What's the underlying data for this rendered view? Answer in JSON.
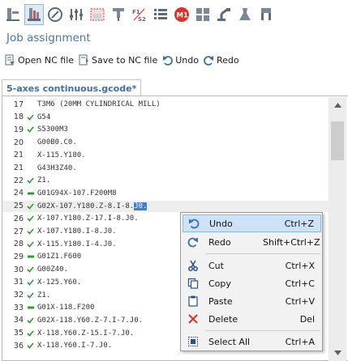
{
  "toolbar": {
    "icons": [
      "machine-setup-icon",
      "job-assignment-icon",
      "compass-icon",
      "sliders-icon",
      "stock-icon",
      "tool-icon",
      "f1-s2-icon",
      "list-icon",
      "m1-icon",
      "grid-icon",
      "robot-icon",
      "lab-icon",
      "gripper-icon"
    ],
    "f1": "F1",
    "s2": "S2",
    "m1": "M1"
  },
  "heading": "Job assignment",
  "actions": {
    "open": "Open NC file",
    "save": "Save to NC file",
    "undo": "Undo",
    "redo": "Redo"
  },
  "document": {
    "tab": "5-axes continuous.gcode*"
  },
  "lines": [
    {
      "num": "17",
      "status": "none",
      "code": "T3M6 (20MM CYLINDRICAL MILL)"
    },
    {
      "num": "18",
      "status": "check",
      "code": "G54"
    },
    {
      "num": "19",
      "status": "check",
      "code": "S5300M3"
    },
    {
      "num": "20",
      "status": "none",
      "code": "G00B0.C0."
    },
    {
      "num": "21",
      "status": "none",
      "code": "X-115.Y180."
    },
    {
      "num": "21",
      "status": "none",
      "code": "G43H3Z40."
    },
    {
      "num": "22",
      "status": "check",
      "code": "Z1."
    },
    {
      "num": "24",
      "status": "dash",
      "code": "G01G94X-107.F200M8"
    },
    {
      "num": "25",
      "status": "check",
      "code": "G02X-107.Y180.Z-8.I-8.",
      "sel": "J0."
    },
    {
      "num": "26",
      "status": "check",
      "code": "X-107.Y180.Z-17.I-8.J0."
    },
    {
      "num": "27",
      "status": "check",
      "code": "X-107.Y180.I-8.J0."
    },
    {
      "num": "28",
      "status": "check",
      "code": "X-115.Y180.I-4.J0."
    },
    {
      "num": "29",
      "status": "dash",
      "code": "G01Z1.F600"
    },
    {
      "num": "30",
      "status": "check",
      "code": "G00Z40."
    },
    {
      "num": "31",
      "status": "check",
      "code": "X-125.Y60."
    },
    {
      "num": "32",
      "status": "check",
      "code": "Z1."
    },
    {
      "num": "33",
      "status": "dash",
      "code": "G01X-118.F200"
    },
    {
      "num": "34",
      "status": "check",
      "code": "G02X-118.Y60.Z-7.I-7.J0."
    },
    {
      "num": "35",
      "status": "check",
      "code": "X-118.Y60.Z-15.I-7.J0."
    },
    {
      "num": "36",
      "status": "check",
      "code": "X-118.Y60.I-7.J0."
    }
  ],
  "context_menu": {
    "undo": {
      "label": "Undo",
      "key": "Ctrl+Z"
    },
    "redo": {
      "label": "Redo",
      "key": "Shift+Ctrl+Z"
    },
    "cut": {
      "label": "Cut",
      "key": "Ctrl+X"
    },
    "copy": {
      "label": "Copy",
      "key": "Ctrl+C"
    },
    "paste": {
      "label": "Paste",
      "key": "Ctrl+V"
    },
    "delete": {
      "label": "Delete",
      "key": "Del"
    },
    "select_all": {
      "label": "Select All",
      "key": "Ctrl+A"
    }
  },
  "colors": {
    "accent": "#4a78a8",
    "check": "#2e9e2e",
    "dash": "#2e9e2e",
    "selection": "#3d7fd1",
    "menu_highlight": "#cde2f7"
  }
}
